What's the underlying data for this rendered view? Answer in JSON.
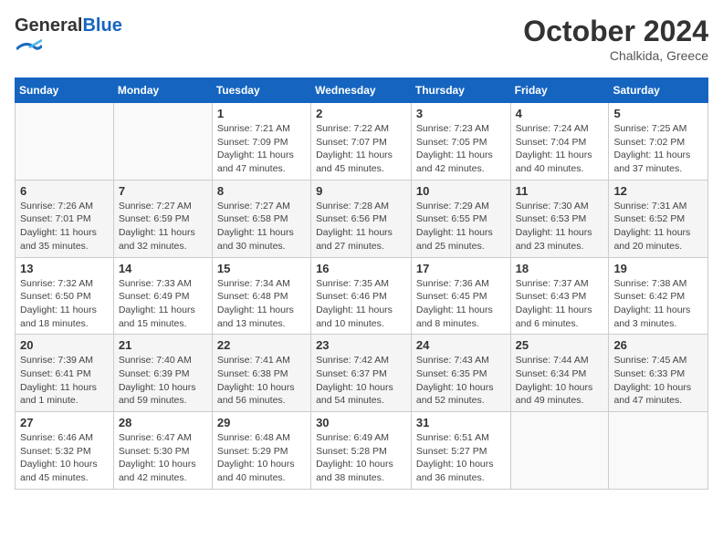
{
  "logo": {
    "general": "General",
    "blue": "Blue"
  },
  "title": "October 2024",
  "location": "Chalkida, Greece",
  "days_header": [
    "Sunday",
    "Monday",
    "Tuesday",
    "Wednesday",
    "Thursday",
    "Friday",
    "Saturday"
  ],
  "weeks": [
    [
      {
        "day": "",
        "info": ""
      },
      {
        "day": "",
        "info": ""
      },
      {
        "day": "1",
        "info": "Sunrise: 7:21 AM\nSunset: 7:09 PM\nDaylight: 11 hours and 47 minutes."
      },
      {
        "day": "2",
        "info": "Sunrise: 7:22 AM\nSunset: 7:07 PM\nDaylight: 11 hours and 45 minutes."
      },
      {
        "day": "3",
        "info": "Sunrise: 7:23 AM\nSunset: 7:05 PM\nDaylight: 11 hours and 42 minutes."
      },
      {
        "day": "4",
        "info": "Sunrise: 7:24 AM\nSunset: 7:04 PM\nDaylight: 11 hours and 40 minutes."
      },
      {
        "day": "5",
        "info": "Sunrise: 7:25 AM\nSunset: 7:02 PM\nDaylight: 11 hours and 37 minutes."
      }
    ],
    [
      {
        "day": "6",
        "info": "Sunrise: 7:26 AM\nSunset: 7:01 PM\nDaylight: 11 hours and 35 minutes."
      },
      {
        "day": "7",
        "info": "Sunrise: 7:27 AM\nSunset: 6:59 PM\nDaylight: 11 hours and 32 minutes."
      },
      {
        "day": "8",
        "info": "Sunrise: 7:27 AM\nSunset: 6:58 PM\nDaylight: 11 hours and 30 minutes."
      },
      {
        "day": "9",
        "info": "Sunrise: 7:28 AM\nSunset: 6:56 PM\nDaylight: 11 hours and 27 minutes."
      },
      {
        "day": "10",
        "info": "Sunrise: 7:29 AM\nSunset: 6:55 PM\nDaylight: 11 hours and 25 minutes."
      },
      {
        "day": "11",
        "info": "Sunrise: 7:30 AM\nSunset: 6:53 PM\nDaylight: 11 hours and 23 minutes."
      },
      {
        "day": "12",
        "info": "Sunrise: 7:31 AM\nSunset: 6:52 PM\nDaylight: 11 hours and 20 minutes."
      }
    ],
    [
      {
        "day": "13",
        "info": "Sunrise: 7:32 AM\nSunset: 6:50 PM\nDaylight: 11 hours and 18 minutes."
      },
      {
        "day": "14",
        "info": "Sunrise: 7:33 AM\nSunset: 6:49 PM\nDaylight: 11 hours and 15 minutes."
      },
      {
        "day": "15",
        "info": "Sunrise: 7:34 AM\nSunset: 6:48 PM\nDaylight: 11 hours and 13 minutes."
      },
      {
        "day": "16",
        "info": "Sunrise: 7:35 AM\nSunset: 6:46 PM\nDaylight: 11 hours and 10 minutes."
      },
      {
        "day": "17",
        "info": "Sunrise: 7:36 AM\nSunset: 6:45 PM\nDaylight: 11 hours and 8 minutes."
      },
      {
        "day": "18",
        "info": "Sunrise: 7:37 AM\nSunset: 6:43 PM\nDaylight: 11 hours and 6 minutes."
      },
      {
        "day": "19",
        "info": "Sunrise: 7:38 AM\nSunset: 6:42 PM\nDaylight: 11 hours and 3 minutes."
      }
    ],
    [
      {
        "day": "20",
        "info": "Sunrise: 7:39 AM\nSunset: 6:41 PM\nDaylight: 11 hours and 1 minute."
      },
      {
        "day": "21",
        "info": "Sunrise: 7:40 AM\nSunset: 6:39 PM\nDaylight: 10 hours and 59 minutes."
      },
      {
        "day": "22",
        "info": "Sunrise: 7:41 AM\nSunset: 6:38 PM\nDaylight: 10 hours and 56 minutes."
      },
      {
        "day": "23",
        "info": "Sunrise: 7:42 AM\nSunset: 6:37 PM\nDaylight: 10 hours and 54 minutes."
      },
      {
        "day": "24",
        "info": "Sunrise: 7:43 AM\nSunset: 6:35 PM\nDaylight: 10 hours and 52 minutes."
      },
      {
        "day": "25",
        "info": "Sunrise: 7:44 AM\nSunset: 6:34 PM\nDaylight: 10 hours and 49 minutes."
      },
      {
        "day": "26",
        "info": "Sunrise: 7:45 AM\nSunset: 6:33 PM\nDaylight: 10 hours and 47 minutes."
      }
    ],
    [
      {
        "day": "27",
        "info": "Sunrise: 6:46 AM\nSunset: 5:32 PM\nDaylight: 10 hours and 45 minutes."
      },
      {
        "day": "28",
        "info": "Sunrise: 6:47 AM\nSunset: 5:30 PM\nDaylight: 10 hours and 42 minutes."
      },
      {
        "day": "29",
        "info": "Sunrise: 6:48 AM\nSunset: 5:29 PM\nDaylight: 10 hours and 40 minutes."
      },
      {
        "day": "30",
        "info": "Sunrise: 6:49 AM\nSunset: 5:28 PM\nDaylight: 10 hours and 38 minutes."
      },
      {
        "day": "31",
        "info": "Sunrise: 6:51 AM\nSunset: 5:27 PM\nDaylight: 10 hours and 36 minutes."
      },
      {
        "day": "",
        "info": ""
      },
      {
        "day": "",
        "info": ""
      }
    ]
  ]
}
